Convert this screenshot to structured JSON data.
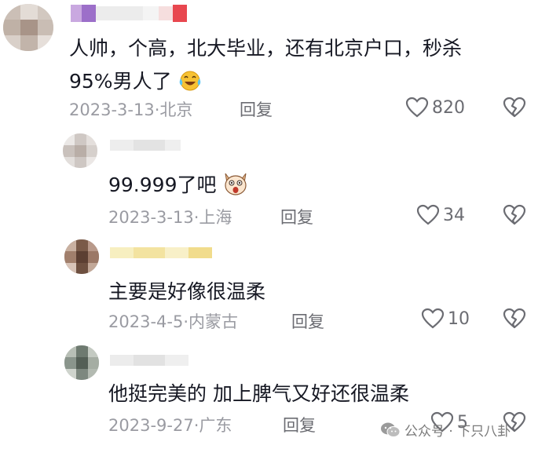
{
  "comments": [
    {
      "text_line1": "人帅，个高，北大毕业，还有北京户口，秒杀",
      "text_line2": "95%男人了",
      "emoji": "crying-laughing-emoji",
      "date": "2023-3-13",
      "location": "北京",
      "reply_label": "回复",
      "likes": "820"
    },
    {
      "text": "99.999了吧",
      "emoji": "shocked-dog-emoji",
      "date": "2023-3-13",
      "location": "上海",
      "reply_label": "回复",
      "likes": "34"
    },
    {
      "text": "主要是好像很温柔",
      "date": "2023-4-5",
      "location": "内蒙古",
      "reply_label": "回复",
      "likes": "10"
    },
    {
      "text": "他挺完美的 加上脾气又好还很温柔",
      "date": "2023-9-27",
      "location": "广东",
      "reply_label": "回复",
      "likes": "5"
    }
  ],
  "watermark": {
    "icon": "wechat-icon",
    "text": "公众号 · 下只八卦"
  },
  "colors": {
    "meta": "#9a9ba2",
    "text": "#161823",
    "icon": "#6b6c72"
  }
}
